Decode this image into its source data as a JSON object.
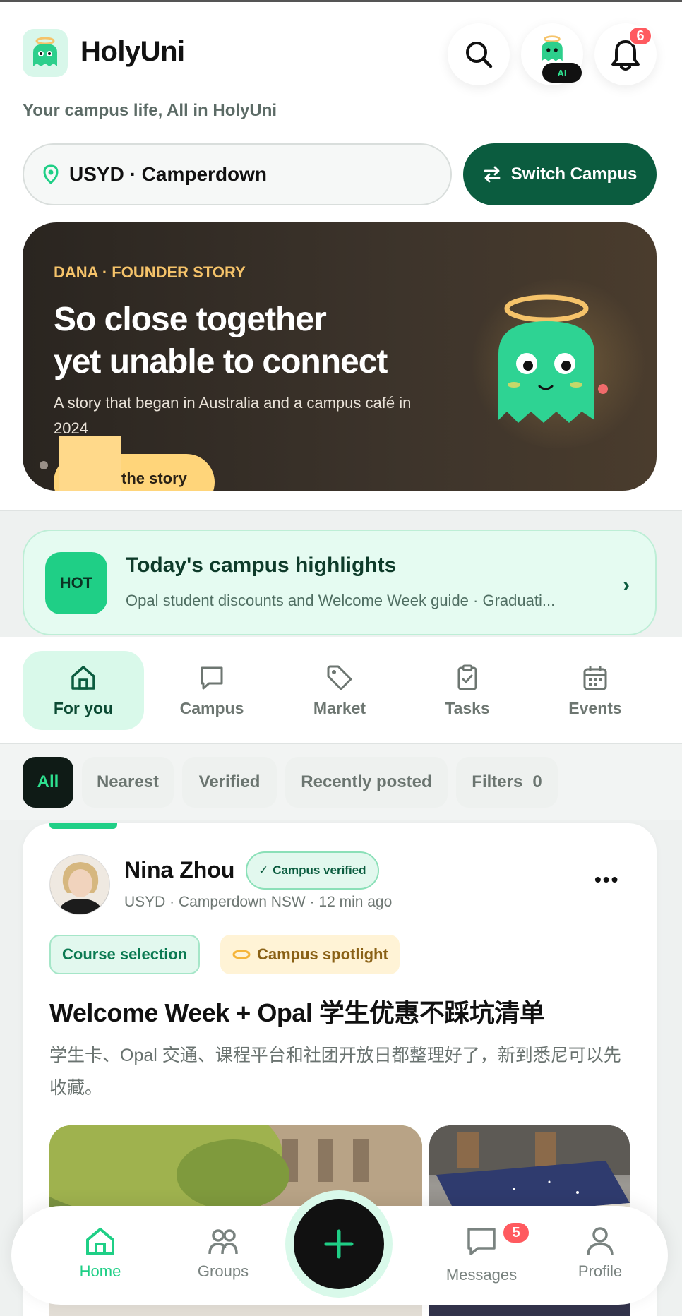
{
  "app": {
    "name": "HolyUni",
    "tagline": "Your campus life, All in HolyUni"
  },
  "header": {
    "ai_label": "AI",
    "notifications_count": "6"
  },
  "campus": {
    "current": "USYD · Camperdown",
    "switch_label": "Switch Campus"
  },
  "hero": {
    "kicker": "DANA · FOUNDER STORY",
    "title_line1": "So close together",
    "title_line2": "yet unable to connect",
    "subtitle": "A story that began in Australia and a campus café in 2024",
    "cta_label": "the story"
  },
  "highlights": {
    "badge": "HOT",
    "title": "Today's campus highlights",
    "subtitle": "Opal student discounts and Welcome Week guide · Graduati..."
  },
  "category_tabs": [
    {
      "label": "For you",
      "icon": "home-icon",
      "active": true
    },
    {
      "label": "Campus",
      "icon": "chat-bubble-icon",
      "active": false
    },
    {
      "label": "Market",
      "icon": "tag-icon",
      "active": false
    },
    {
      "label": "Tasks",
      "icon": "clipboard-check-icon",
      "active": false
    },
    {
      "label": "Events",
      "icon": "calendar-icon",
      "active": false
    }
  ],
  "filters": [
    {
      "label": "All",
      "active": true
    },
    {
      "label": "Nearest"
    },
    {
      "label": "Verified"
    },
    {
      "label": "Recently posted"
    },
    {
      "label": "Filters",
      "count": "0"
    }
  ],
  "post": {
    "author": "Nina Zhou",
    "verified_label": "Campus verified",
    "meta": "USYD · Camperdown NSW · 12 min ago",
    "tags": [
      "Course selection",
      "Campus spotlight"
    ],
    "title": "Welcome Week + Opal 学生优惠不踩坑清单",
    "body": "学生卡、Opal 交通、课程平台和社团开放日都整理好了，新到悉尼可以先收藏。"
  },
  "bottom_nav": [
    {
      "label": "Home",
      "icon": "home-icon",
      "active": true
    },
    {
      "label": "Groups",
      "icon": "people-icon"
    },
    {
      "label": "Messages",
      "icon": "message-icon",
      "badge": "5"
    },
    {
      "label": "Profile",
      "icon": "person-icon"
    }
  ],
  "colors": {
    "brand_dark": "#0b5c3f",
    "brand_green": "#1fcf86",
    "hero_accent": "#f5c36a",
    "badge_red": "#ff5a5f"
  }
}
